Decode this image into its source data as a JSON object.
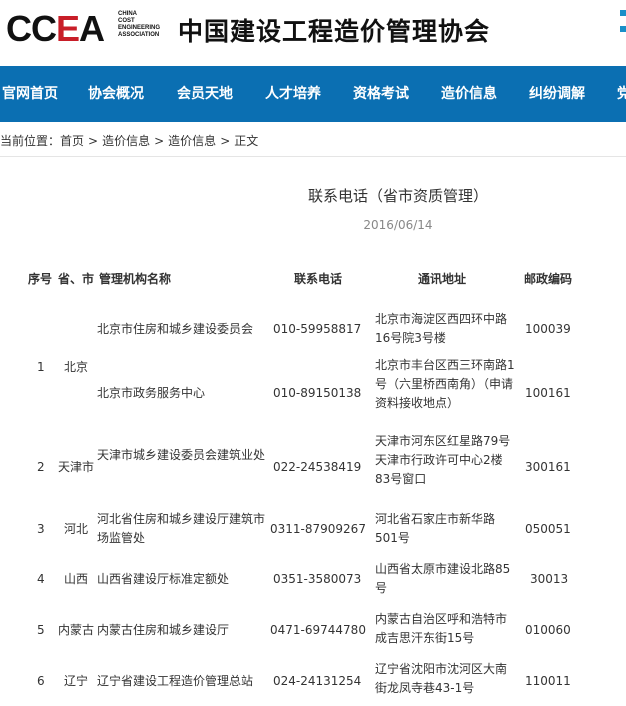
{
  "header": {
    "logo_letters_a": "CC",
    "logo_letters_e": "E",
    "logo_letters_b": "A",
    "logo_sub": [
      "CHINA",
      "COST",
      "ENGINEERING",
      "ASSOCIATION"
    ],
    "org_name": "中国建设工程造价管理协会"
  },
  "nav": [
    "官网首页",
    "协会概况",
    "会员天地",
    "人才培养",
    "资格考试",
    "造价信息",
    "纠纷调解",
    "党"
  ],
  "breadcrumb": {
    "prefix": "当前位置：",
    "items": [
      "首页",
      "造价信息",
      "造价信息",
      "正文"
    ],
    "separator": ">"
  },
  "article": {
    "title": "联系电话（省市资质管理）",
    "date": "2016/06/14"
  },
  "table": {
    "headers": [
      "序号",
      "省、市",
      "管理机构名称",
      "联系电话",
      "通讯地址",
      "邮政编码"
    ],
    "rows": [
      {
        "no": "1",
        "prov": "北京",
        "org": "北京市住房和城乡建设委员会",
        "tel": "010-59958817",
        "addr": "北京市海淀区西四环中路16号院3号楼",
        "zip": "100039"
      },
      {
        "no": "",
        "prov": "",
        "org": "北京市政务服务中心",
        "tel": "010-89150138",
        "addr": "北京市丰台区西三环南路1号（六里桥西南角）（申请资料接收地点）",
        "zip": "100161"
      },
      {
        "no": "2",
        "prov": "天津市",
        "org": "天津市城乡建设委员会建筑业处",
        "tel": "022-24538419",
        "addr": "天津市河东区红星路79号天津市行政许可中心2楼83号窗口",
        "zip": "300161"
      },
      {
        "no": "3",
        "prov": "河北",
        "org": "河北省住房和城乡建设厅建筑市场监管处",
        "tel": "0311-87909267",
        "addr": "河北省石家庄市新华路501号",
        "zip": "050051"
      },
      {
        "no": "4",
        "prov": "山西",
        "org": "山西省建设厅标准定额处",
        "tel": "0351-3580073",
        "addr": "山西省太原市建设北路85号",
        "zip": "30013"
      },
      {
        "no": "5",
        "prov": "内蒙古",
        "org": "内蒙古住房和城乡建设厅",
        "tel": "0471-69744780",
        "addr": "内蒙古自治区呼和浩特市成吉思汗东街15号",
        "zip": "010060"
      },
      {
        "no": "6",
        "prov": "辽宁",
        "org": "辽宁省建设工程造价管理总站",
        "tel": "024-24131254",
        "addr": "辽宁省沈阳市沈河区大南街龙凤寺巷43-1号",
        "zip": "110011"
      }
    ]
  }
}
